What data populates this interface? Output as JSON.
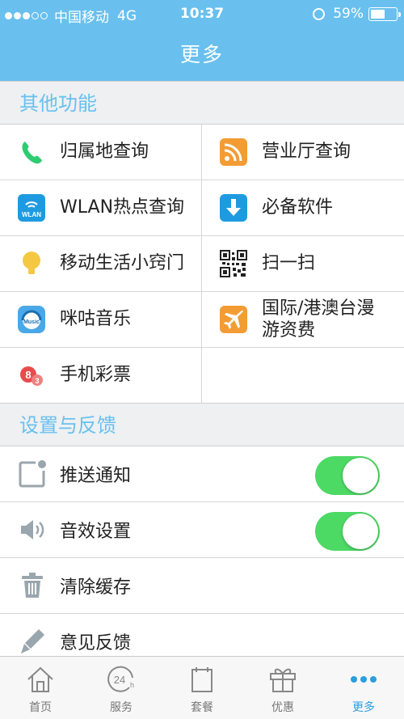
{
  "status": {
    "carrier": "中国移动",
    "network": "4G",
    "time": "10:37",
    "battery": "59%",
    "battery_level": 0.59
  },
  "header": {
    "title": "更多"
  },
  "section_features": {
    "title": "其他功能"
  },
  "features": [
    {
      "label": "归属地查询",
      "icon": "phone-icon",
      "color": "#2ecc71"
    },
    {
      "label": "营业厅查询",
      "icon": "rss-icon",
      "color": "#f39c34"
    },
    {
      "label": "WLAN热点查询",
      "icon": "wlan-icon",
      "color": "#1e9be0"
    },
    {
      "label": "必备软件",
      "icon": "download-icon",
      "color": "#1e9be0"
    },
    {
      "label": "移动生活小窍门",
      "icon": "lightbulb-icon",
      "color": "#f5c842"
    },
    {
      "label": "扫一扫",
      "icon": "qr-code-icon",
      "color": "#222222"
    },
    {
      "label": "咪咕音乐",
      "icon": "music-icon",
      "color": "#4aa8e8"
    },
    {
      "label": "国际/港澳台漫游资费",
      "icon": "airplane-icon",
      "color": "#f39c34"
    },
    {
      "label": "手机彩票",
      "icon": "lottery-icon",
      "color": "#e74c4c"
    }
  ],
  "section_settings": {
    "title": "设置与反馈"
  },
  "settings": [
    {
      "label": "推送通知",
      "icon": "notification-icon",
      "toggle": true
    },
    {
      "label": "音效设置",
      "icon": "speaker-icon",
      "toggle": true
    },
    {
      "label": "清除缓存",
      "icon": "trash-icon"
    },
    {
      "label": "意见反馈",
      "icon": "pen-icon"
    }
  ],
  "tabs": [
    {
      "label": "首页",
      "icon": "home-icon"
    },
    {
      "label": "服务",
      "icon": "24h-icon"
    },
    {
      "label": "套餐",
      "icon": "package-icon"
    },
    {
      "label": "优惠",
      "icon": "gift-icon"
    },
    {
      "label": "更多",
      "icon": "more-icon",
      "active": true
    }
  ],
  "colors": {
    "accent": "#69c0ee",
    "toggle_on": "#4cd964",
    "tab_active": "#2a9ee0"
  }
}
